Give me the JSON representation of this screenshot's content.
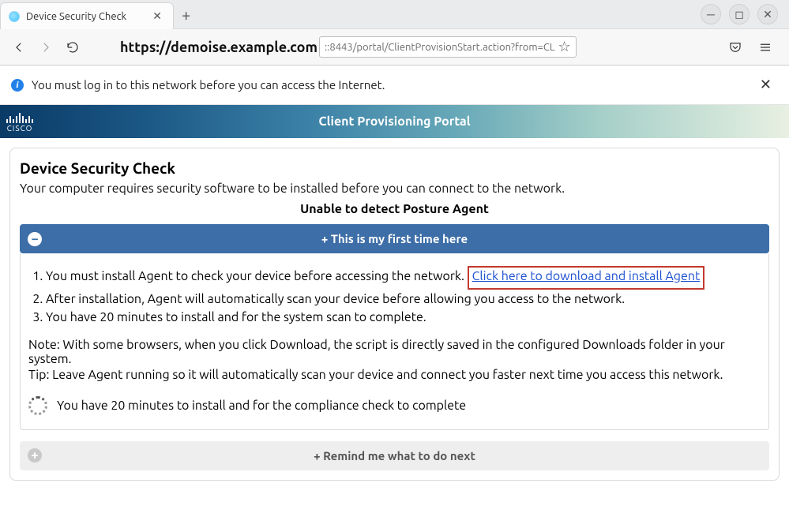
{
  "browser": {
    "tab_title": "Device Security Check",
    "url_domain": "https://demoise.example.com",
    "url_rest": "::8443/portal/ClientProvisionStart.action?from=CL"
  },
  "info_banner": {
    "text": "You must log in to this network before you can access the Internet."
  },
  "header": {
    "logo_word": "CISCO",
    "title": "Client Provisioning Portal"
  },
  "card": {
    "heading": "Device Security Check",
    "sub": "Your computer requires security software to be installed before you can connect to the network.",
    "detect": "Unable to detect Posture Agent"
  },
  "acc1": {
    "label": "+ This is my first time here",
    "step1_pre": "You must install Agent to check your device before accessing the network. ",
    "step1_link": "Click here to download and install Agent",
    "step2": "After installation, Agent will automatically scan your device before allowing you access to the network.",
    "step3": "You have 20 minutes to install and for the system scan to complete.",
    "note": "Note: With some browsers, when you click Download, the script is directly saved in the configured Downloads folder in your system.",
    "tip": "Tip: Leave Agent running so it will automatically scan your device and connect you faster next time you access this network.",
    "spinner_text": "You have 20 minutes to install and for the compliance check to complete"
  },
  "acc2": {
    "label": "+ Remind me what to do next"
  }
}
